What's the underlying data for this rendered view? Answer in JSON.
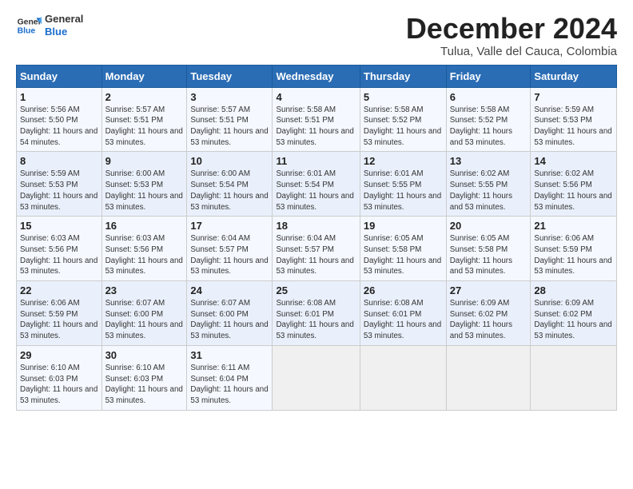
{
  "logo": {
    "text_general": "General",
    "text_blue": "Blue"
  },
  "header": {
    "title": "December 2024",
    "subtitle": "Tulua, Valle del Cauca, Colombia"
  },
  "calendar": {
    "days_of_week": [
      "Sunday",
      "Monday",
      "Tuesday",
      "Wednesday",
      "Thursday",
      "Friday",
      "Saturday"
    ],
    "weeks": [
      [
        {
          "day": "",
          "empty": true
        },
        {
          "day": "",
          "empty": true
        },
        {
          "day": "",
          "empty": true
        },
        {
          "day": "",
          "empty": true
        },
        {
          "day": "",
          "empty": true
        },
        {
          "day": "",
          "empty": true
        },
        {
          "day": "",
          "empty": true
        }
      ],
      [
        {
          "day": "1",
          "sunrise": "5:56 AM",
          "sunset": "5:50 PM",
          "daylight": "11 hours and 54 minutes."
        },
        {
          "day": "2",
          "sunrise": "5:57 AM",
          "sunset": "5:51 PM",
          "daylight": "11 hours and 53 minutes."
        },
        {
          "day": "3",
          "sunrise": "5:57 AM",
          "sunset": "5:51 PM",
          "daylight": "11 hours and 53 minutes."
        },
        {
          "day": "4",
          "sunrise": "5:58 AM",
          "sunset": "5:51 PM",
          "daylight": "11 hours and 53 minutes."
        },
        {
          "day": "5",
          "sunrise": "5:58 AM",
          "sunset": "5:52 PM",
          "daylight": "11 hours and 53 minutes."
        },
        {
          "day": "6",
          "sunrise": "5:58 AM",
          "sunset": "5:52 PM",
          "daylight": "11 hours and 53 minutes."
        },
        {
          "day": "7",
          "sunrise": "5:59 AM",
          "sunset": "5:53 PM",
          "daylight": "11 hours and 53 minutes."
        }
      ],
      [
        {
          "day": "8",
          "sunrise": "5:59 AM",
          "sunset": "5:53 PM",
          "daylight": "11 hours and 53 minutes."
        },
        {
          "day": "9",
          "sunrise": "6:00 AM",
          "sunset": "5:53 PM",
          "daylight": "11 hours and 53 minutes."
        },
        {
          "day": "10",
          "sunrise": "6:00 AM",
          "sunset": "5:54 PM",
          "daylight": "11 hours and 53 minutes."
        },
        {
          "day": "11",
          "sunrise": "6:01 AM",
          "sunset": "5:54 PM",
          "daylight": "11 hours and 53 minutes."
        },
        {
          "day": "12",
          "sunrise": "6:01 AM",
          "sunset": "5:55 PM",
          "daylight": "11 hours and 53 minutes."
        },
        {
          "day": "13",
          "sunrise": "6:02 AM",
          "sunset": "5:55 PM",
          "daylight": "11 hours and 53 minutes."
        },
        {
          "day": "14",
          "sunrise": "6:02 AM",
          "sunset": "5:56 PM",
          "daylight": "11 hours and 53 minutes."
        }
      ],
      [
        {
          "day": "15",
          "sunrise": "6:03 AM",
          "sunset": "5:56 PM",
          "daylight": "11 hours and 53 minutes."
        },
        {
          "day": "16",
          "sunrise": "6:03 AM",
          "sunset": "5:56 PM",
          "daylight": "11 hours and 53 minutes."
        },
        {
          "day": "17",
          "sunrise": "6:04 AM",
          "sunset": "5:57 PM",
          "daylight": "11 hours and 53 minutes."
        },
        {
          "day": "18",
          "sunrise": "6:04 AM",
          "sunset": "5:57 PM",
          "daylight": "11 hours and 53 minutes."
        },
        {
          "day": "19",
          "sunrise": "6:05 AM",
          "sunset": "5:58 PM",
          "daylight": "11 hours and 53 minutes."
        },
        {
          "day": "20",
          "sunrise": "6:05 AM",
          "sunset": "5:58 PM",
          "daylight": "11 hours and 53 minutes."
        },
        {
          "day": "21",
          "sunrise": "6:06 AM",
          "sunset": "5:59 PM",
          "daylight": "11 hours and 53 minutes."
        }
      ],
      [
        {
          "day": "22",
          "sunrise": "6:06 AM",
          "sunset": "5:59 PM",
          "daylight": "11 hours and 53 minutes."
        },
        {
          "day": "23",
          "sunrise": "6:07 AM",
          "sunset": "6:00 PM",
          "daylight": "11 hours and 53 minutes."
        },
        {
          "day": "24",
          "sunrise": "6:07 AM",
          "sunset": "6:00 PM",
          "daylight": "11 hours and 53 minutes."
        },
        {
          "day": "25",
          "sunrise": "6:08 AM",
          "sunset": "6:01 PM",
          "daylight": "11 hours and 53 minutes."
        },
        {
          "day": "26",
          "sunrise": "6:08 AM",
          "sunset": "6:01 PM",
          "daylight": "11 hours and 53 minutes."
        },
        {
          "day": "27",
          "sunrise": "6:09 AM",
          "sunset": "6:02 PM",
          "daylight": "11 hours and 53 minutes."
        },
        {
          "day": "28",
          "sunrise": "6:09 AM",
          "sunset": "6:02 PM",
          "daylight": "11 hours and 53 minutes."
        }
      ],
      [
        {
          "day": "29",
          "sunrise": "6:10 AM",
          "sunset": "6:03 PM",
          "daylight": "11 hours and 53 minutes."
        },
        {
          "day": "30",
          "sunrise": "6:10 AM",
          "sunset": "6:03 PM",
          "daylight": "11 hours and 53 minutes."
        },
        {
          "day": "31",
          "sunrise": "6:11 AM",
          "sunset": "6:04 PM",
          "daylight": "11 hours and 53 minutes."
        },
        {
          "day": "",
          "empty": true
        },
        {
          "day": "",
          "empty": true
        },
        {
          "day": "",
          "empty": true
        },
        {
          "day": "",
          "empty": true
        }
      ]
    ]
  }
}
